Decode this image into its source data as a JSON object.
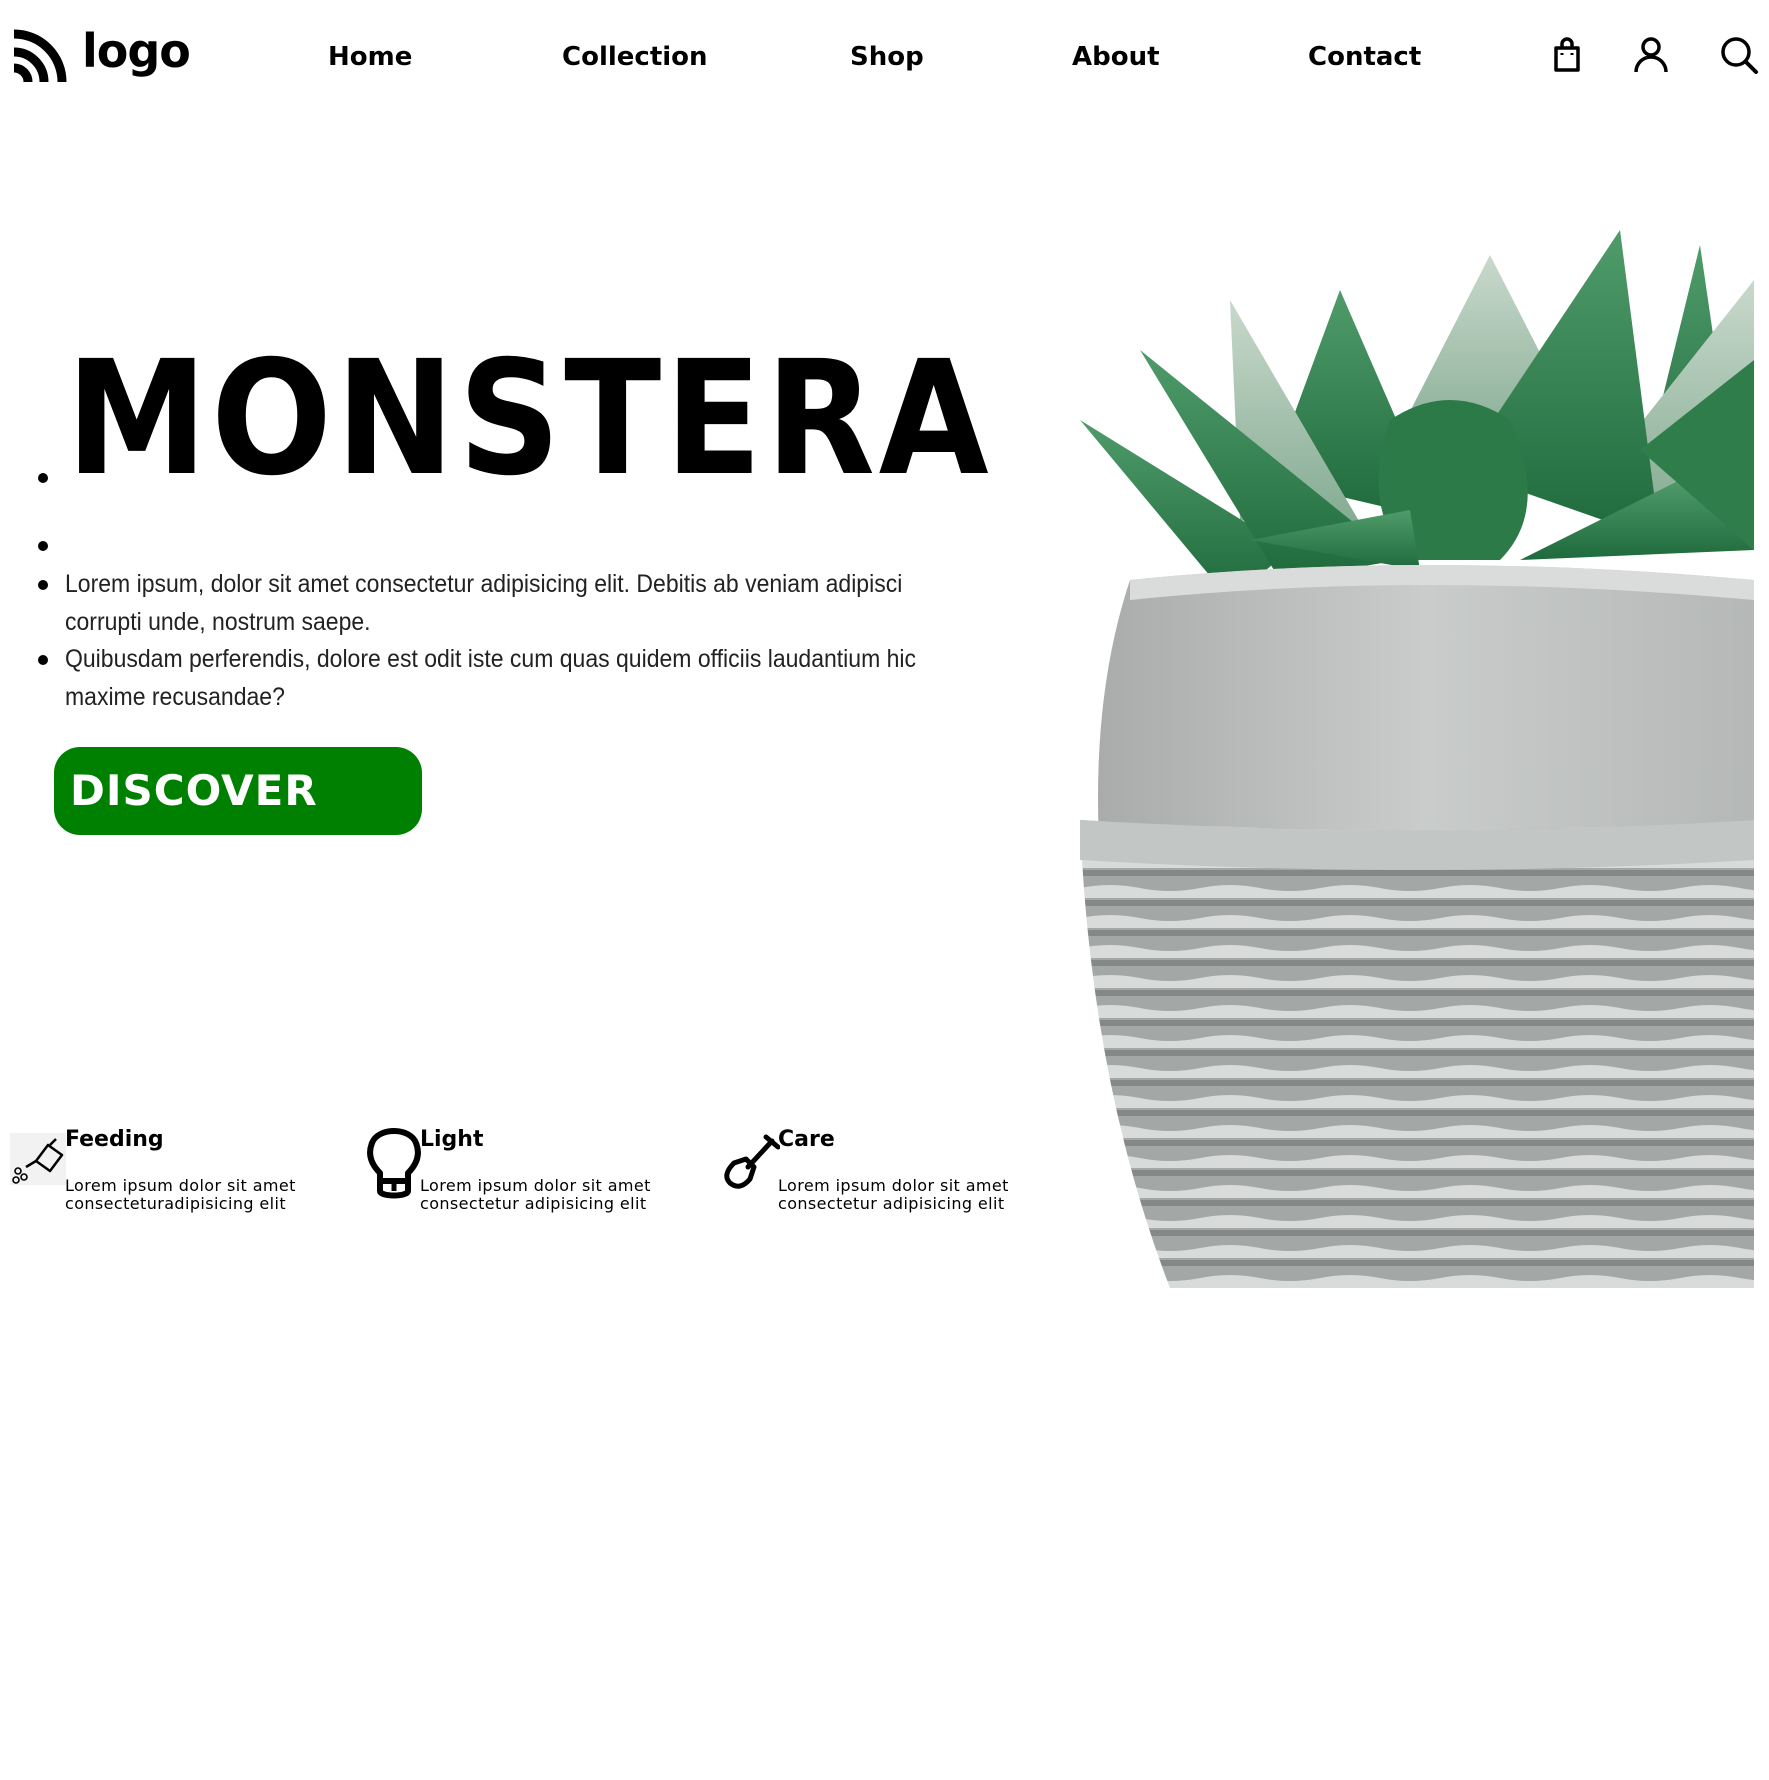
{
  "header": {
    "logo_text": "logo",
    "nav": [
      {
        "label": "Home"
      },
      {
        "label": "Collection"
      },
      {
        "label": "Shop"
      },
      {
        "label": "About"
      },
      {
        "label": "Contact"
      }
    ],
    "icons": [
      "shopping-bag-icon",
      "user-icon",
      "search-icon"
    ]
  },
  "hero": {
    "title": "MONSTERA",
    "paragraphs": [
      "Lorem ipsum, dolor sit amet consectetur adipisicing elit. Debitis ab veniam adipisci corrupti unde, nostrum saepe.",
      "Quibusdam perferendis, dolore est odit iste cum quas quidem officiis laudantium hic maxime recusandae?"
    ],
    "button_label": "DISCOVER",
    "button_color": "#008000"
  },
  "features": [
    {
      "title": "Feeding",
      "text": "Lorem ipsum dolor sit amet consecteturadipisicing elit",
      "icon": "watering-can-icon"
    },
    {
      "title": "Light",
      "text": "Lorem ipsum dolor sit amet consectetur adipisicing elit",
      "icon": "lightbulb-icon"
    },
    {
      "title": "Care",
      "text": "Lorem ipsum dolor sit amet consectetur adipisicing elit",
      "icon": "shovel-icon"
    }
  ]
}
